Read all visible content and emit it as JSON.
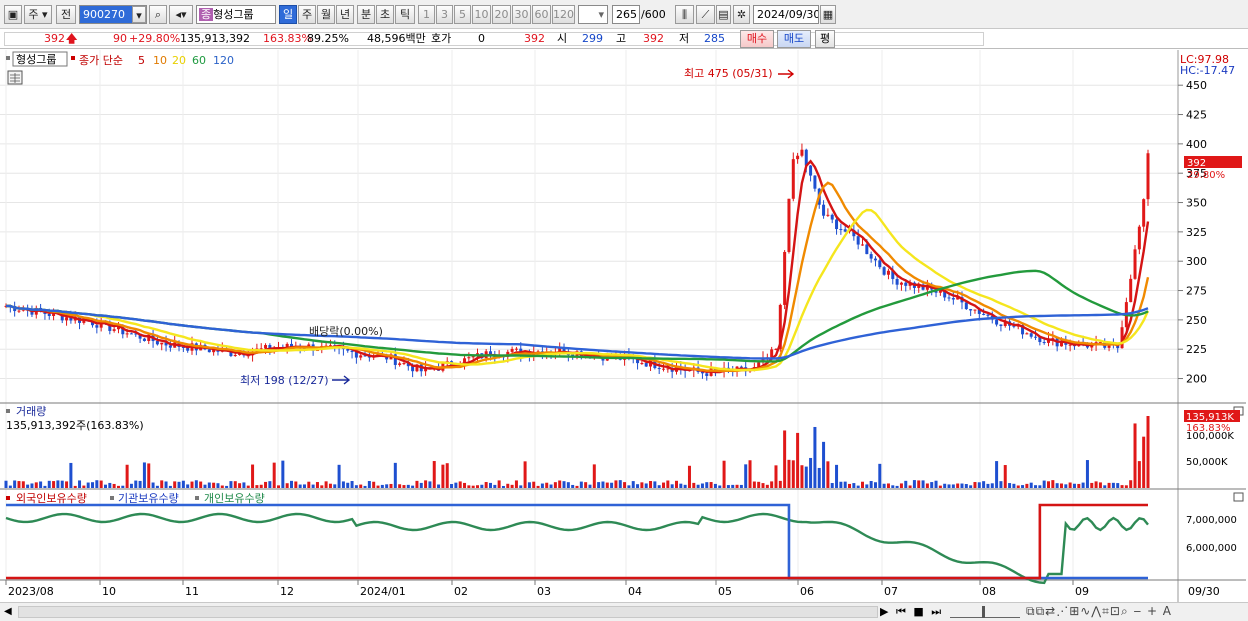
{
  "toolbar": {
    "mode": "주",
    "prev": "전",
    "code": "900270",
    "name": "형성그룹",
    "periods": [
      "일",
      "주",
      "월",
      "년",
      "분",
      "초",
      "틱"
    ],
    "minutes": [
      "1",
      "3",
      "5",
      "10",
      "20",
      "30",
      "60",
      "120"
    ],
    "count": "265",
    "count_max": "/600",
    "date": "2024/09/30"
  },
  "quote": {
    "price": "392",
    "change": "90",
    "change_pct": "+29.80%",
    "volume": "135,913,392",
    "vol_ratio": "163.83%",
    "turnover_pct": "89.25%",
    "amount": "48,596백만",
    "hoga_label": "호가",
    "hoga": "0",
    "hoga2": "392",
    "open_label": "시",
    "open": "299",
    "high_label": "고",
    "high": "392",
    "low_label": "저",
    "low": "285",
    "buy": "매수",
    "sell": "매도",
    "avg": "평"
  },
  "legend": {
    "name": "형성그룹",
    "ma_label": "종가 단순",
    "ma": [
      "5",
      "10",
      "20",
      "60",
      "120"
    ]
  },
  "annotations": {
    "high": "최고 475 (05/31)",
    "low": "최저 198 (12/27)",
    "dividend": "배당락(0.00%)"
  },
  "axis_labels": {
    "lc": "LC:97.98",
    "hc": "HC:-17.47",
    "last_price": "392",
    "last_pct": "29.80%",
    "vol_last": "135,913K",
    "vol_last_pct": "163.83%",
    "vol_tick": "100,000K",
    "vol_tick2": "50,000K",
    "own_tick1": "7,000,000",
    "own_tick2": "6,000,000",
    "date_end": "09/30"
  },
  "volume_panel": {
    "title": "거래량",
    "value": "135,913,392주(163.83%)"
  },
  "ownership_panel": {
    "series": [
      "외국인보유수량",
      "기관보유수량",
      "개인보유수량"
    ]
  },
  "chart_data": {
    "type": "candlestick",
    "price_ticks": [
      450,
      425,
      400,
      375,
      350,
      325,
      300,
      275,
      250,
      225,
      200
    ],
    "price_range": [
      180,
      480
    ],
    "x_labels": [
      "2023/08",
      "10",
      "11",
      "12",
      "2024/01",
      "02",
      "03",
      "04",
      "05",
      "06",
      "07",
      "08",
      "09"
    ],
    "last_close": 392,
    "high": 475,
    "low": 198,
    "moving_averages": {
      "5": "red",
      "10": "orange",
      "20": "yellow",
      "60": "green",
      "120": "blue"
    },
    "volume_ticks_k": [
      100000,
      50000
    ],
    "ownership_ticks": [
      7000000,
      6000000
    ]
  }
}
